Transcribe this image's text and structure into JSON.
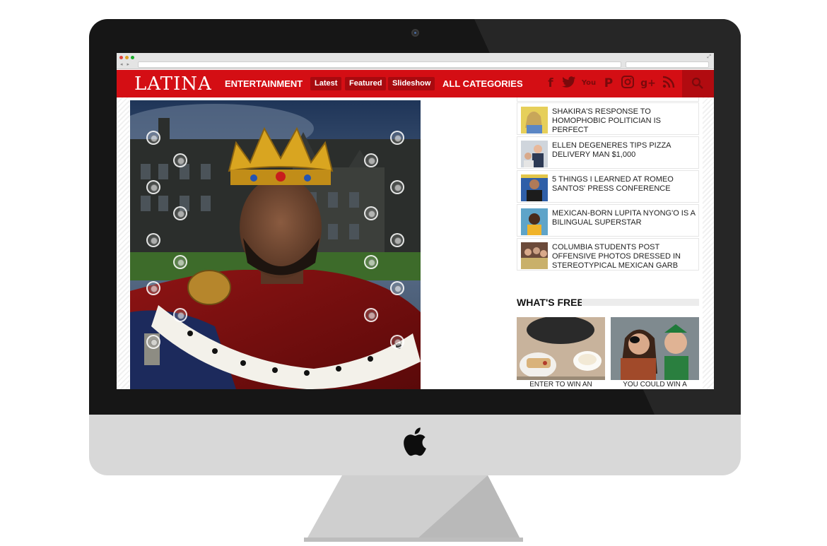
{
  "site": {
    "logo": "LATINA",
    "nav": {
      "section": "ENTERTAINMENT",
      "pills": [
        "Latest",
        "Featured",
        "Slideshow"
      ],
      "all_categories": "ALL CATEGORIES"
    },
    "social_icons": [
      "facebook-icon",
      "twitter-icon",
      "youtube-icon",
      "pinterest-icon",
      "instagram-icon",
      "google-plus-icon",
      "rss-icon"
    ]
  },
  "sidebar": {
    "stories": [
      {
        "title": "SHAKIRA'S RESPONSE TO HOMOPHOBIC POLITICIAN IS PERFECT"
      },
      {
        "title": "ELLEN DEGENERES TIPS PIZZA DELIVERY MAN $1,000"
      },
      {
        "title": "5 THINGS I LEARNED AT ROMEO SANTOS' PRESS CONFERENCE"
      },
      {
        "title": "MEXICAN-BORN LUPITA NYONG'O IS A BILINGUAL SUPERSTAR"
      },
      {
        "title": "COLUMBIA STUDENTS POST OFFENSIVE PHOTOS DRESSED IN STEREOTYPICAL MEXICAN GARB"
      }
    ],
    "whats_free": {
      "label": "WHAT'S FREE",
      "items": [
        {
          "caption": "ENTER TO WIN AN"
        },
        {
          "caption": "YOU COULD WIN A"
        }
      ]
    }
  },
  "colors": {
    "brand_red": "#d40e14",
    "pill_red": "#a80a0f",
    "bezel": "#161616",
    "chin": "#d8d8d8"
  }
}
